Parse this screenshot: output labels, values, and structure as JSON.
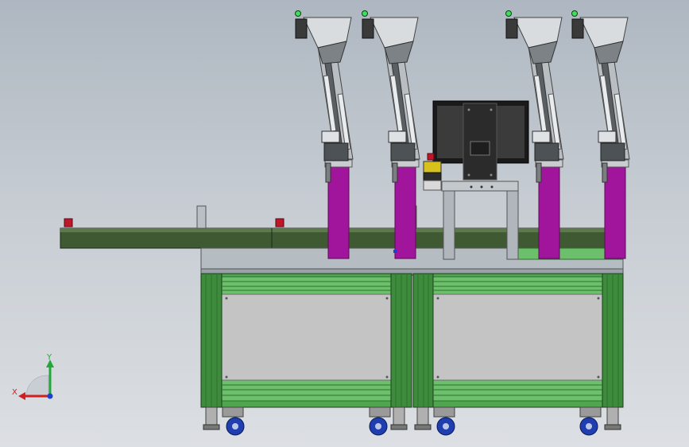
{
  "viewport": {
    "background_top": "#aeb7c1",
    "background_bottom": "#dcdfe3"
  },
  "machine": {
    "frame_color": "#4fa64f",
    "frame_dark": "#2f6f2f",
    "belt_color": "#3f5a33",
    "column_color": "#a0159b",
    "panel_color": "#c4c4c4",
    "caster_color": "#1f3fb0",
    "feeder_count": 4,
    "estop_color": "#c0162a",
    "beacon_color": "#3ee05a"
  },
  "triad": {
    "x_label": "X",
    "y_label": "Y",
    "x_color": "#d01f1f",
    "y_color": "#22a83a",
    "z_color": "#1f3fd0"
  }
}
